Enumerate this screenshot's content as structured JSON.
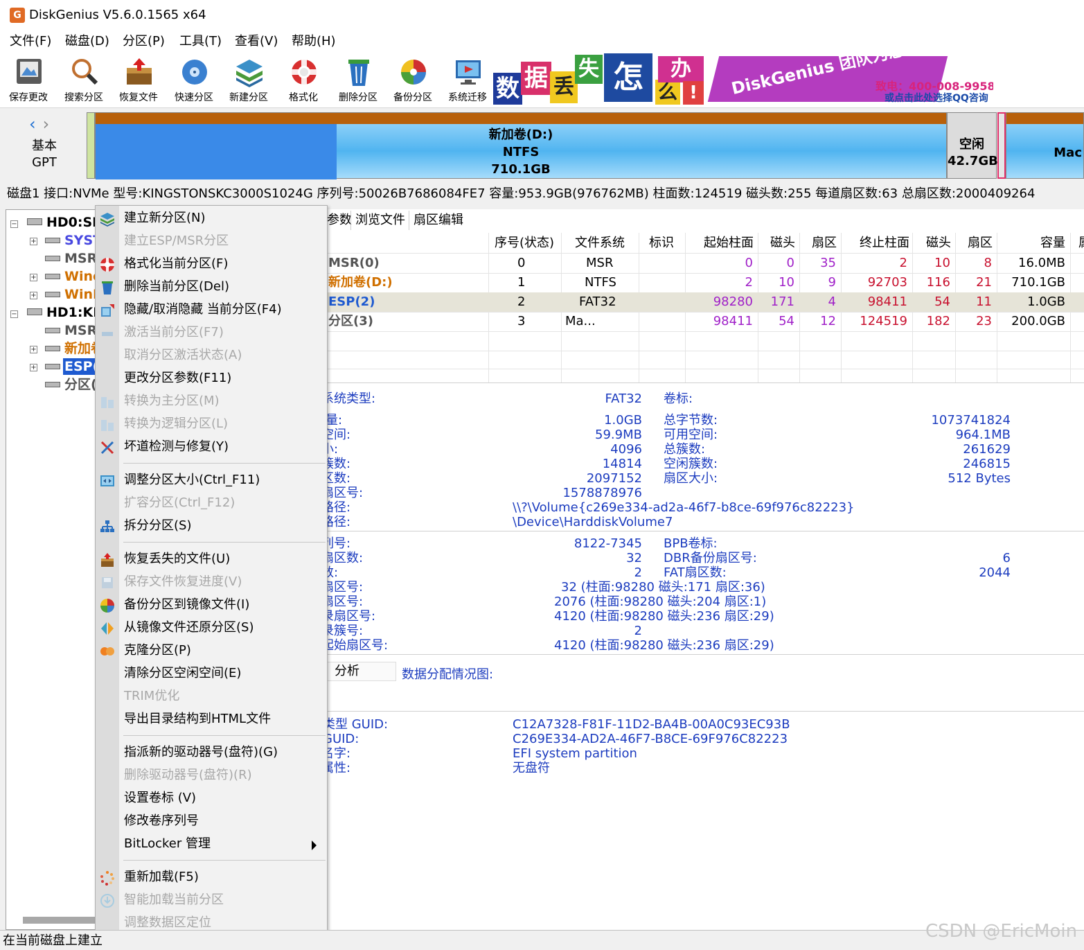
{
  "window": {
    "title": "DiskGenius V5.6.0.1565 x64",
    "logo_glyph": "G"
  },
  "menubar": [
    "文件(F)",
    "磁盘(D)",
    "分区(P)",
    "工具(T)",
    "查看(V)",
    "帮助(H)"
  ],
  "toolbar": [
    {
      "label": "保存更改",
      "icon": "save-icon"
    },
    {
      "label": "搜索分区",
      "icon": "magnifier-icon"
    },
    {
      "label": "恢复文件",
      "icon": "recover-box-icon"
    },
    {
      "label": "快速分区",
      "icon": "disk-icon"
    },
    {
      "label": "新建分区",
      "icon": "layers-icon"
    },
    {
      "label": "格式化",
      "icon": "lifebuoy-icon"
    },
    {
      "label": "删除分区",
      "icon": "trash-icon"
    },
    {
      "label": "备份分区",
      "icon": "pie-icon"
    },
    {
      "label": "系统迁移",
      "icon": "monitor-icon"
    }
  ],
  "banner": {
    "tiles": [
      "数",
      "据",
      "丢",
      "失",
      "怎",
      "么",
      "办",
      "!"
    ],
    "tagline": "DiskGenius 团队为您服务",
    "phone": "致电：400-008-9958",
    "qq": "或点击此处选择QQ咨询"
  },
  "diskmap": {
    "disk_type": [
      "基本",
      "GPT"
    ],
    "partitions": [
      {
        "name": "新加卷(D:)",
        "fs": "NTFS",
        "size": "710.1GB"
      },
      {
        "name": "空闲",
        "size": "42.7GB"
      },
      {
        "name": "Mac"
      }
    ]
  },
  "diskinfo": "磁盘1 接口:NVMe  型号:KINGSTONSKC3000S1024G  序列号:50026B7686084FE7  容量:953.9GB(976762MB)  柱面数:124519  磁头数:255  每道扇区数:63  总扇区数:2000409264",
  "tree": [
    {
      "label": "HD0:SK",
      "level": 0
    },
    {
      "label": "SYST",
      "level": 1,
      "color": "#4848e0"
    },
    {
      "label": "MSR",
      "level": 1,
      "color": "#555555"
    },
    {
      "label": "Winc",
      "level": 1,
      "color": "#d07000"
    },
    {
      "label": "WinR",
      "level": 1,
      "color": "#d07000"
    },
    {
      "label": "HD1:KIN",
      "level": 0
    },
    {
      "label": "MSR",
      "level": 1,
      "color": "#555555"
    },
    {
      "label": "新加卷",
      "level": 1,
      "color": "#d07000"
    },
    {
      "label": "ESP(",
      "level": 1,
      "color": "#ffffff",
      "selected": true
    },
    {
      "label": "分区(",
      "level": 1,
      "color": "#555555"
    }
  ],
  "tabs": [
    "参数",
    "浏览文件",
    "扇区编辑"
  ],
  "grid": {
    "headers": [
      "序号(状态)",
      "文件系统",
      "标识",
      "起始柱面",
      "磁头",
      "扇区",
      "终止柱面",
      "磁头",
      "扇区",
      "容量",
      "属"
    ],
    "rows": [
      [
        "MSR(0)",
        "0",
        "MSR",
        "",
        "0",
        "0",
        "35",
        "2",
        "10",
        "8",
        "16.0MB"
      ],
      [
        "新加卷(D:)",
        "1",
        "NTFS",
        "",
        "2",
        "10",
        "9",
        "92703",
        "116",
        "21",
        "710.1GB"
      ],
      [
        "ESP(2)",
        "2",
        "FAT32",
        "",
        "98280",
        "171",
        "4",
        "98411",
        "54",
        "11",
        "1.0GB"
      ],
      [
        "分区(3)",
        "3",
        "Ma...",
        "",
        "98411",
        "54",
        "12",
        "124519",
        "182",
        "23",
        "200.0GB"
      ]
    ]
  },
  "info1": {
    "fs_type_label": "系统类型:",
    "fs_type": "FAT32",
    "vol_label": "卷标:",
    "left": [
      {
        "k": "量:",
        "v": "1.0GB"
      },
      {
        "k": "空间:",
        "v": "59.9MB"
      },
      {
        "k": "小:",
        "v": "4096"
      },
      {
        "k": "簇数:",
        "v": "14814"
      },
      {
        "k": "区数:",
        "v": "2097152"
      },
      {
        "k": "扇区号:",
        "v": "1578878976"
      }
    ],
    "right": [
      {
        "k": "总字节数:",
        "v": "1073741824"
      },
      {
        "k": "可用空间:",
        "v": "964.1MB"
      },
      {
        "k": "总簇数:",
        "v": "261629"
      },
      {
        "k": "空闲簇数:",
        "v": "246815"
      },
      {
        "k": "扇区大小:",
        "v": "512 Bytes"
      }
    ],
    "path1_label": "路径:",
    "path1": "\\\\?\\Volume{c269e334-ad2a-46f7-b8ce-69f976c82223}",
    "path2_label": "路径:",
    "path2": "\\Device\\HarddiskVolume7"
  },
  "info2": {
    "left": [
      {
        "k": "列号:",
        "v": "8122-7345"
      },
      {
        "k": "扇区数:",
        "v": "32"
      },
      {
        "k": "数:",
        "v": "2"
      }
    ],
    "right": [
      {
        "k": "BPB卷标:",
        "v": ""
      },
      {
        "k": "DBR备份扇区号:",
        "v": "6"
      },
      {
        "k": "FAT扇区数:",
        "v": "2044"
      }
    ],
    "rows": [
      {
        "k": "扇区号:",
        "v": "32 (柱面:98280 磁头:171 扇区:36)"
      },
      {
        "k": "扇区号:",
        "v": "2076 (柱面:98280 磁头:204 扇区:1)"
      },
      {
        "k": "录扇区号:",
        "v": "4120 (柱面:98280 磁头:236 扇区:29)"
      },
      {
        "k": "录簇号:",
        "v": "2"
      },
      {
        "k": "起始扇区号:",
        "v": "4120 (柱面:98280 磁头:236 扇区:29)"
      }
    ]
  },
  "analyze": {
    "button": "分析",
    "label": "数据分配情况图:"
  },
  "guid": [
    {
      "k": "类型 GUID:",
      "v": "C12A7328-F81F-11D2-BA4B-00A0C93EC93B"
    },
    {
      "k": "GUID:",
      "v": "C269E334-AD2A-46F7-B8CE-69F976C82223"
    },
    {
      "k": "名字:",
      "v": "EFI system partition"
    },
    {
      "k": "属性:",
      "v": "无盘符"
    }
  ],
  "context_menu": [
    {
      "label": "建立新分区(N)",
      "icon": "layers-icon",
      "disabled": false
    },
    {
      "label": "建立ESP/MSR分区",
      "icon": "",
      "disabled": true
    },
    {
      "label": "格式化当前分区(F)",
      "icon": "lifebuoy-icon",
      "disabled": false
    },
    {
      "label": "删除当前分区(Del)",
      "icon": "trash-icon",
      "disabled": false
    },
    {
      "label": "隐藏/取消隐藏 当前分区(F4)",
      "icon": "hide-icon",
      "disabled": false
    },
    {
      "label": "激活当前分区(F7)",
      "icon": "activate-icon",
      "disabled": true
    },
    {
      "label": "取消分区激活状态(A)",
      "icon": "",
      "disabled": true
    },
    {
      "label": "更改分区参数(F11)",
      "icon": "",
      "disabled": false
    },
    {
      "label": "转换为主分区(M)",
      "icon": "convert-icon",
      "disabled": true
    },
    {
      "label": "转换为逻辑分区(L)",
      "icon": "convert-icon",
      "disabled": true
    },
    {
      "label": "坏道检测与修复(Y)",
      "icon": "tools-icon",
      "disabled": false
    },
    {
      "sep": true
    },
    {
      "label": "调整分区大小(Ctrl_F11)",
      "icon": "resize-icon",
      "disabled": false
    },
    {
      "label": "扩容分区(Ctrl_F12)",
      "icon": "",
      "disabled": true
    },
    {
      "label": "拆分分区(S)",
      "icon": "split-icon",
      "disabled": false
    },
    {
      "sep": true
    },
    {
      "label": "恢复丢失的文件(U)",
      "icon": "recover-box-icon",
      "disabled": false
    },
    {
      "label": "保存文件恢复进度(V)",
      "icon": "save-progress-icon",
      "disabled": true
    },
    {
      "label": "备份分区到镜像文件(I)",
      "icon": "pie-icon",
      "disabled": false
    },
    {
      "label": "从镜像文件还原分区(S)",
      "icon": "restore-icon",
      "disabled": false
    },
    {
      "label": "克隆分区(P)",
      "icon": "clone-icon",
      "disabled": false
    },
    {
      "label": "清除分区空闲空间(E)",
      "icon": "",
      "disabled": false
    },
    {
      "label": "TRIM优化",
      "icon": "",
      "disabled": true
    },
    {
      "label": "导出目录结构到HTML文件",
      "icon": "",
      "disabled": false
    },
    {
      "sep": true
    },
    {
      "label": "指派新的驱动器号(盘符)(G)",
      "icon": "",
      "disabled": false
    },
    {
      "label": "删除驱动器号(盘符)(R)",
      "icon": "",
      "disabled": true
    },
    {
      "label": "设置卷标 (V)",
      "icon": "",
      "disabled": false
    },
    {
      "label": "修改卷序列号",
      "icon": "",
      "disabled": false
    },
    {
      "label": "BitLocker 管理",
      "icon": "",
      "disabled": false,
      "submenu": true
    },
    {
      "sep": true
    },
    {
      "label": "重新加载(F5)",
      "icon": "reload-icon",
      "disabled": false
    },
    {
      "label": "智能加载当前分区",
      "icon": "smart-load-icon",
      "disabled": true
    },
    {
      "label": "调整数据区定位",
      "icon": "",
      "disabled": true
    }
  ],
  "status": "在当前磁盘上建立",
  "watermark": "CSDN @EricMoin",
  "colors": {
    "accent_blue": "#1c3cbf",
    "purple_num": "#a020c8",
    "red_num": "#c8102e",
    "orange": "#d07000",
    "banner_purple": "#b43cbf"
  }
}
